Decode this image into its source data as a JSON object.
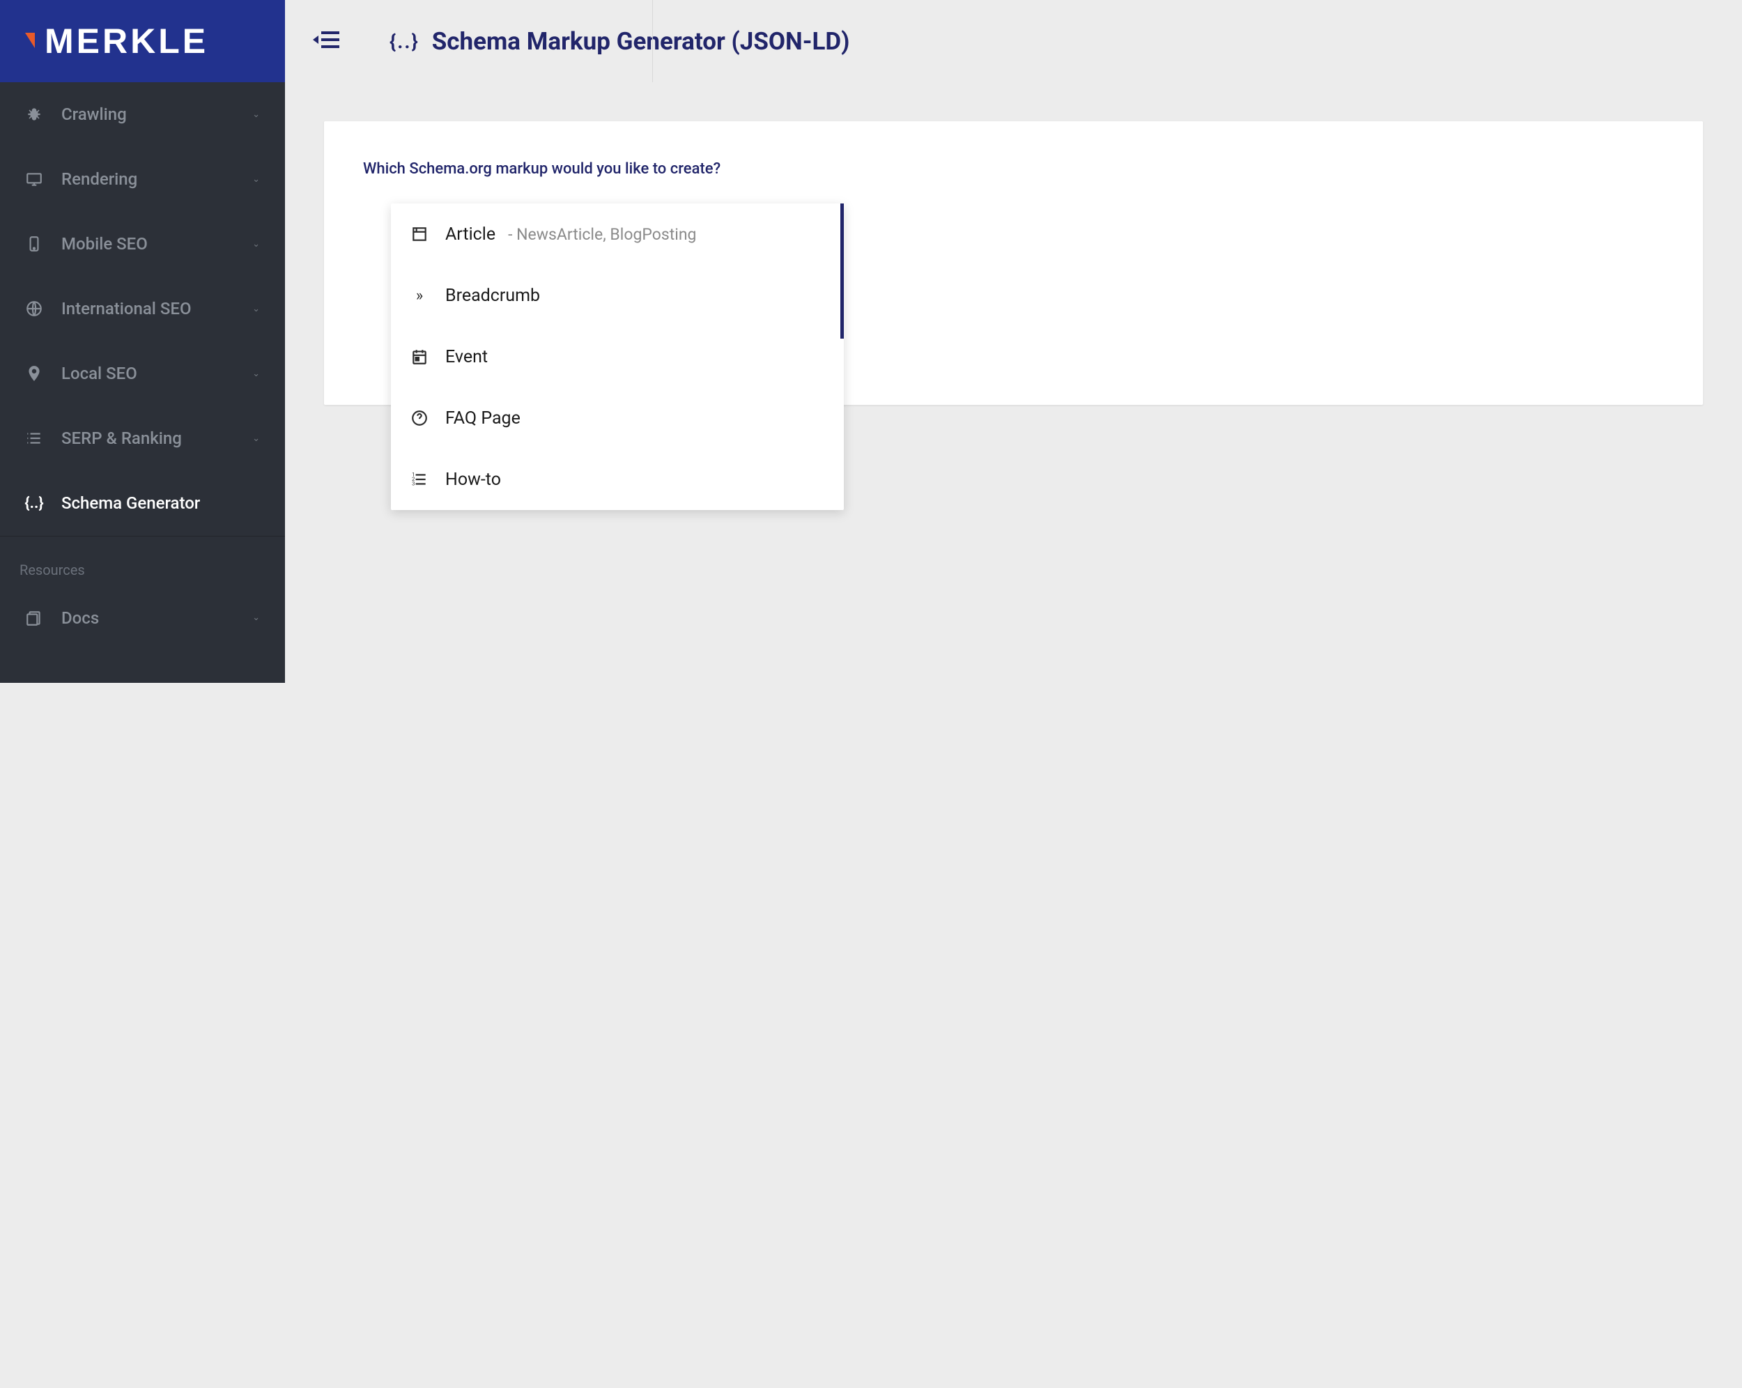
{
  "logo": "MERKLE",
  "page_title": "Schema Markup Generator (JSON-LD)",
  "title_icon_glyph": "{..}",
  "sidebar": {
    "items": [
      {
        "icon": "bug-icon",
        "label": "Crawling",
        "expandable": true
      },
      {
        "icon": "monitor-icon",
        "label": "Rendering",
        "expandable": true
      },
      {
        "icon": "mobile-icon",
        "label": "Mobile SEO",
        "expandable": true
      },
      {
        "icon": "globe-icon",
        "label": "International SEO",
        "expandable": true
      },
      {
        "icon": "pin-icon",
        "label": "Local SEO",
        "expandable": true
      },
      {
        "icon": "list-icon",
        "label": "SERP & Ranking",
        "expandable": true
      },
      {
        "icon": "braces-icon",
        "label": "Schema Generator",
        "expandable": false,
        "active": true
      }
    ],
    "resources_label": "Resources",
    "resources_items": [
      {
        "icon": "docs-icon",
        "label": "Docs",
        "expandable": true
      }
    ]
  },
  "card": {
    "prompt": "Which Schema.org markup would you like to create?"
  },
  "dropdown": {
    "options": [
      {
        "icon": "article-icon",
        "label": "Article",
        "sub": " - NewsArticle, BlogPosting"
      },
      {
        "icon": "arrows-icon",
        "label": "Breadcrumb",
        "sub": ""
      },
      {
        "icon": "calendar-icon",
        "label": "Event",
        "sub": ""
      },
      {
        "icon": "help-icon",
        "label": "FAQ Page",
        "sub": ""
      },
      {
        "icon": "steps-icon",
        "label": "How-to",
        "sub": ""
      }
    ]
  }
}
